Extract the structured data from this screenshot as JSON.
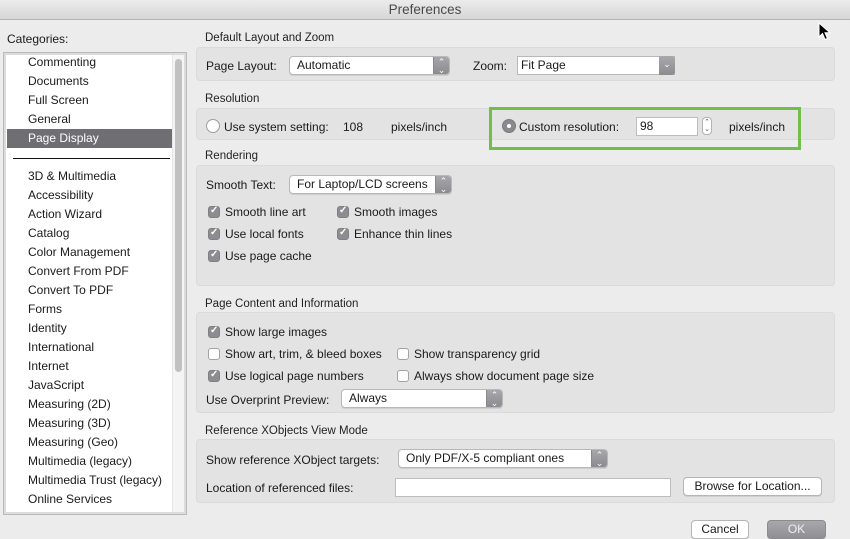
{
  "window": {
    "title": "Preferences"
  },
  "categories": {
    "label": "Categories:",
    "top_items": [
      {
        "label": "Commenting",
        "selected": false
      },
      {
        "label": "Documents",
        "selected": false
      },
      {
        "label": "Full Screen",
        "selected": false
      },
      {
        "label": "General",
        "selected": false
      },
      {
        "label": "Page Display",
        "selected": true
      }
    ],
    "items": [
      "3D & Multimedia",
      "Accessibility",
      "Action Wizard",
      "Catalog",
      "Color Management",
      "Convert From PDF",
      "Convert To PDF",
      "Forms",
      "Identity",
      "International",
      "Internet",
      "JavaScript",
      "Measuring (2D)",
      "Measuring (3D)",
      "Measuring (Geo)",
      "Multimedia (legacy)",
      "Multimedia Trust (legacy)",
      "Online Services"
    ]
  },
  "layout_zoom": {
    "title": "Default Layout and Zoom",
    "page_layout_label": "Page Layout:",
    "page_layout_value": "Automatic",
    "zoom_label": "Zoom:",
    "zoom_value": "Fit Page"
  },
  "resolution": {
    "title": "Resolution",
    "system_label": "Use system setting:",
    "system_value": "108",
    "system_unit": "pixels/inch",
    "system_selected": false,
    "custom_label": "Custom resolution:",
    "custom_value": "98",
    "custom_unit": "pixels/inch",
    "custom_selected": true,
    "highlight_color": "#6fbf4a"
  },
  "rendering": {
    "title": "Rendering",
    "smooth_text_label": "Smooth Text:",
    "smooth_text_value": "For Laptop/LCD screens",
    "checkboxes": [
      {
        "label": "Smooth line art",
        "checked": true
      },
      {
        "label": "Smooth images",
        "checked": true
      },
      {
        "label": "Use local fonts",
        "checked": true
      },
      {
        "label": "Enhance thin lines",
        "checked": true
      },
      {
        "label": "Use page cache",
        "checked": true
      }
    ]
  },
  "page_content": {
    "title": "Page Content and Information",
    "checkboxes": [
      {
        "label": "Show large images",
        "checked": true
      },
      {
        "label": "Show art, trim, & bleed boxes",
        "checked": false
      },
      {
        "label": "Show transparency grid",
        "checked": false
      },
      {
        "label": "Use logical page numbers",
        "checked": true
      },
      {
        "label": "Always show document page size",
        "checked": false
      }
    ],
    "overprint_label": "Use Overprint Preview:",
    "overprint_value": "Always"
  },
  "xobjects": {
    "title": "Reference XObjects View Mode",
    "targets_label": "Show reference XObject targets:",
    "targets_value": "Only PDF/X-5 compliant ones",
    "location_label": "Location of referenced files:",
    "location_value": "",
    "browse_label": "Browse for Location..."
  },
  "footer": {
    "cancel_label": "Cancel",
    "ok_label": "OK"
  }
}
